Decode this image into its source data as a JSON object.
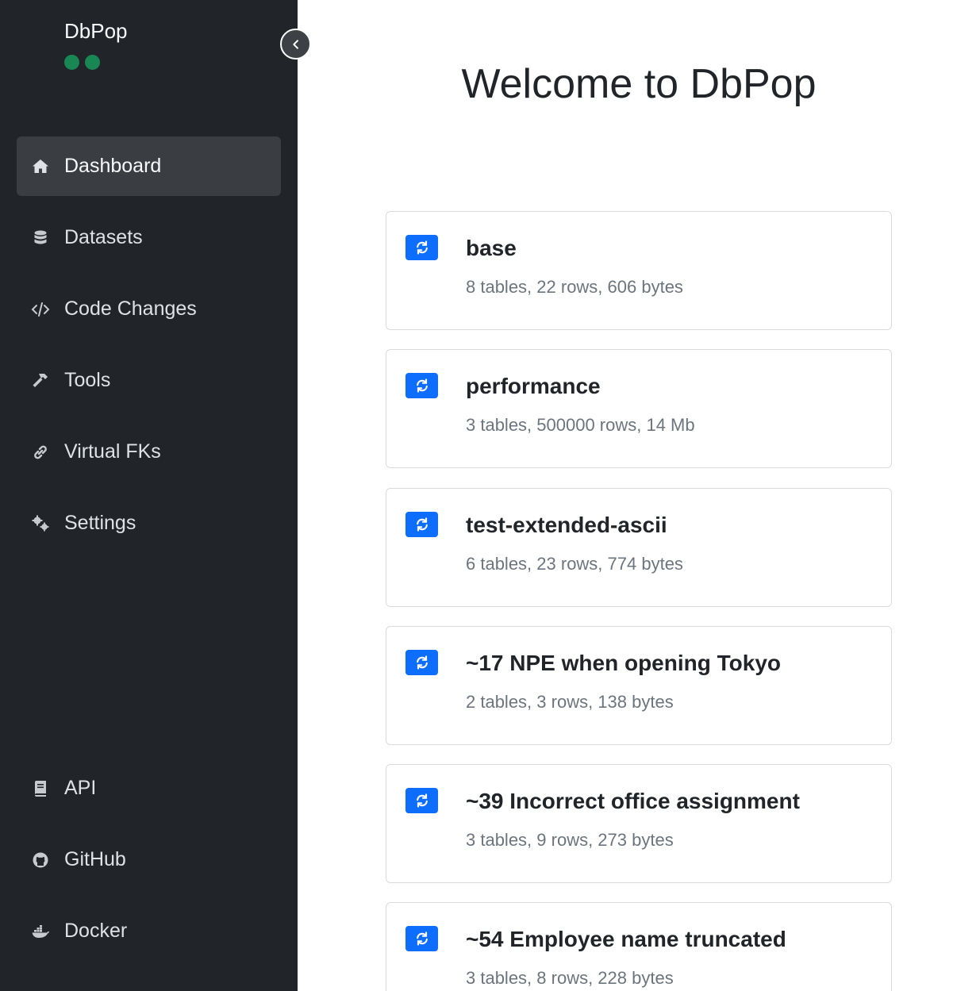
{
  "app": {
    "name": "DbPop",
    "status_dots": 2
  },
  "sidebar": {
    "collapse_icon": "chevron-left-icon",
    "nav": [
      {
        "label": "Dashboard",
        "icon": "house-icon",
        "active": true
      },
      {
        "label": "Datasets",
        "icon": "database-icon"
      },
      {
        "label": "Code Changes",
        "icon": "code-icon"
      },
      {
        "label": "Tools",
        "icon": "hammer-icon"
      },
      {
        "label": "Virtual FKs",
        "icon": "link-icon"
      },
      {
        "label": "Settings",
        "icon": "gears-icon"
      }
    ],
    "footer": [
      {
        "label": "API",
        "icon": "book-icon"
      },
      {
        "label": "GitHub",
        "icon": "github-icon"
      },
      {
        "label": "Docker",
        "icon": "docker-icon"
      }
    ]
  },
  "main": {
    "title": "Welcome to DbPop",
    "datasets": [
      {
        "name": "base",
        "summary": "8 tables, 22 rows, 606 bytes"
      },
      {
        "name": "performance",
        "summary": "3 tables, 500000 rows, 14 Mb"
      },
      {
        "name": "test-extended-ascii",
        "summary": "6 tables, 23 rows, 774 bytes"
      },
      {
        "name": "~17 NPE when opening Tokyo",
        "summary": "2 tables, 3 rows, 138 bytes"
      },
      {
        "name": "~39 Incorrect office assignment",
        "summary": "3 tables, 9 rows, 273 bytes"
      },
      {
        "name": "~54 Employee name truncated",
        "summary": "3 tables, 8 rows, 228 bytes"
      }
    ]
  },
  "colors": {
    "sidebar_bg": "#212529",
    "accent": "#0d6efd",
    "status": "#198754"
  }
}
